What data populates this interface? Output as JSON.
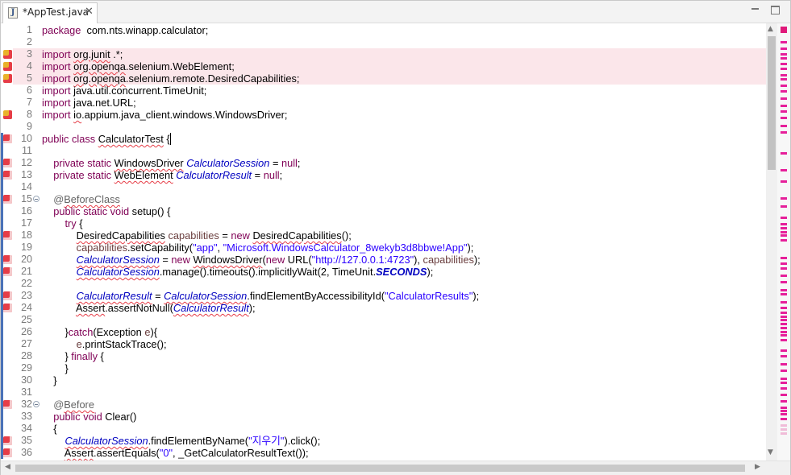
{
  "tab": {
    "icon": "java-file-icon",
    "title": "*AppTest.java",
    "close_glyph": "☒"
  },
  "window_buttons": {
    "minimize": "minimize-icon",
    "maximize": "maximize-icon"
  },
  "colors": {
    "keyword": "#7f0055",
    "string": "#2a00ff",
    "field": "#0000c0",
    "error": "#e63d47",
    "ruler_mark": "#e61f9a",
    "change_bar": "#4a72b8"
  },
  "editor": {
    "lines": [
      {
        "n": "1",
        "tokens": [
          [
            "kw",
            "package"
          ],
          [
            "",
            "  com.nts.winapp.calculator;"
          ]
        ]
      },
      {
        "n": "2",
        "tokens": []
      },
      {
        "n": "3",
        "tokens": [
          [
            "kw",
            "import"
          ],
          [
            "",
            " "
          ],
          [
            "sq",
            "org.junit"
          ],
          [
            "",
            " .*;"
          ]
        ]
      },
      {
        "n": "4",
        "tokens": [
          [
            "kw",
            "import"
          ],
          [
            "",
            " "
          ],
          [
            "sq",
            "org.openqa"
          ],
          [
            "",
            ".selenium.WebElement;"
          ]
        ]
      },
      {
        "n": "5",
        "tokens": [
          [
            "kw",
            "import"
          ],
          [
            "",
            " "
          ],
          [
            "sq",
            "org.openqa"
          ],
          [
            "",
            ".selenium.remote.DesiredCapabilities;"
          ]
        ]
      },
      {
        "n": "6",
        "tokens": [
          [
            "kw",
            "import"
          ],
          [
            "",
            " java.util.concurrent.TimeUnit;"
          ]
        ]
      },
      {
        "n": "7",
        "tokens": [
          [
            "kw",
            "import"
          ],
          [
            "",
            " java.net.URL;"
          ]
        ]
      },
      {
        "n": "8",
        "tokens": [
          [
            "kw",
            "import"
          ],
          [
            "",
            " "
          ],
          [
            "sq",
            "io"
          ],
          [
            "",
            ".appium.java_client.windows.WindowsDriver;"
          ]
        ]
      },
      {
        "n": "9",
        "tokens": []
      },
      {
        "n": "10",
        "tokens": [
          [
            "kw",
            "public class"
          ],
          [
            "",
            " "
          ],
          [
            "sq",
            "CalculatorTest"
          ],
          [
            "",
            " "
          ],
          [
            "caret",
            "{"
          ]
        ]
      },
      {
        "n": "11",
        "tokens": []
      },
      {
        "n": "12",
        "tokens": [
          [
            "",
            "    "
          ],
          [
            "kw",
            "private static"
          ],
          [
            "",
            " "
          ],
          [
            "sq",
            "WindowsDriver"
          ],
          [
            "",
            " "
          ],
          [
            "it",
            "CalculatorSession"
          ],
          [
            "",
            " = "
          ],
          [
            "kw",
            "null"
          ],
          [
            "",
            ";"
          ]
        ]
      },
      {
        "n": "13",
        "tokens": [
          [
            "",
            "    "
          ],
          [
            "kw",
            "private static"
          ],
          [
            "",
            " "
          ],
          [
            "sq",
            "WebElement"
          ],
          [
            "",
            " "
          ],
          [
            "it",
            "CalculatorResult"
          ],
          [
            "",
            " = "
          ],
          [
            "kw",
            "null"
          ],
          [
            "",
            ";"
          ]
        ]
      },
      {
        "n": "14",
        "tokens": []
      },
      {
        "n": "15",
        "tokens": [
          [
            "",
            "    "
          ],
          [
            "an",
            "@"
          ],
          [
            "ansq",
            "BeforeClass"
          ]
        ]
      },
      {
        "n": "16",
        "tokens": [
          [
            "",
            "    "
          ],
          [
            "kw",
            "public static void"
          ],
          [
            "",
            " setup() {"
          ]
        ]
      },
      {
        "n": "17",
        "tokens": [
          [
            "",
            "        "
          ],
          [
            "kw",
            "try"
          ],
          [
            "",
            " {"
          ]
        ]
      },
      {
        "n": "18",
        "tokens": [
          [
            "",
            "            "
          ],
          [
            "sq",
            "DesiredCapabilities"
          ],
          [
            "",
            " "
          ],
          [
            "var",
            "capabilities"
          ],
          [
            "",
            " = "
          ],
          [
            "kw",
            "new"
          ],
          [
            "",
            " "
          ],
          [
            "sq",
            "DesiredCapabilities"
          ],
          [
            "",
            "();"
          ]
        ]
      },
      {
        "n": "19",
        "tokens": [
          [
            "",
            "            "
          ],
          [
            "var",
            "capabilities"
          ],
          [
            "",
            ".setCapability("
          ],
          [
            "str",
            "\"app\""
          ],
          [
            "",
            ", "
          ],
          [
            "str",
            "\"Microsoft.WindowsCalculator_8wekyb3d8bbwe!App\""
          ],
          [
            "",
            ");"
          ]
        ]
      },
      {
        "n": "20",
        "tokens": [
          [
            "",
            "            "
          ],
          [
            "itsq",
            "CalculatorSession"
          ],
          [
            "",
            " = "
          ],
          [
            "kw",
            "new"
          ],
          [
            "",
            " "
          ],
          [
            "sq",
            "WindowsDriver"
          ],
          [
            "",
            "("
          ],
          [
            "kw",
            "new"
          ],
          [
            "",
            " URL("
          ],
          [
            "str",
            "\"http://127.0.0.1:4723\""
          ],
          [
            "",
            "), "
          ],
          [
            "var",
            "capabilities"
          ],
          [
            "",
            ");"
          ]
        ]
      },
      {
        "n": "21",
        "tokens": [
          [
            "",
            "            "
          ],
          [
            "itsq",
            "CalculatorSession"
          ],
          [
            "",
            ".manage().timeouts().implicitlyWait(2, TimeUnit."
          ],
          [
            "itb",
            "SECONDS"
          ],
          [
            "",
            ");"
          ]
        ]
      },
      {
        "n": "22",
        "tokens": []
      },
      {
        "n": "23",
        "tokens": [
          [
            "",
            "            "
          ],
          [
            "itsq",
            "CalculatorResult"
          ],
          [
            "",
            " = "
          ],
          [
            "itsq",
            "CalculatorSession"
          ],
          [
            "",
            ".findElementByAccessibilityId("
          ],
          [
            "str",
            "\"CalculatorResults\""
          ],
          [
            "",
            ");"
          ]
        ]
      },
      {
        "n": "24",
        "tokens": [
          [
            "",
            "            "
          ],
          [
            "sq",
            "Assert"
          ],
          [
            "",
            ".assertNotNull("
          ],
          [
            "itsq",
            "CalculatorResult"
          ],
          [
            "",
            ");"
          ]
        ]
      },
      {
        "n": "25",
        "tokens": []
      },
      {
        "n": "26",
        "tokens": [
          [
            "",
            "        }"
          ],
          [
            "kw",
            "catch"
          ],
          [
            "",
            "(Exception "
          ],
          [
            "var",
            "e"
          ],
          [
            "",
            "){"
          ]
        ]
      },
      {
        "n": "27",
        "tokens": [
          [
            "",
            "            "
          ],
          [
            "var",
            "e"
          ],
          [
            "",
            ".printStackTrace();"
          ]
        ]
      },
      {
        "n": "28",
        "tokens": [
          [
            "",
            "        } "
          ],
          [
            "kw",
            "finally"
          ],
          [
            "",
            " {"
          ]
        ]
      },
      {
        "n": "29",
        "tokens": [
          [
            "",
            "        }"
          ]
        ]
      },
      {
        "n": "30",
        "tokens": [
          [
            "",
            "    }"
          ]
        ]
      },
      {
        "n": "31",
        "tokens": []
      },
      {
        "n": "32",
        "tokens": [
          [
            "",
            "    "
          ],
          [
            "an",
            "@"
          ],
          [
            "ansq",
            "Before"
          ]
        ]
      },
      {
        "n": "33",
        "tokens": [
          [
            "",
            "    "
          ],
          [
            "kw",
            "public void"
          ],
          [
            "",
            " Clear()"
          ]
        ]
      },
      {
        "n": "34",
        "tokens": [
          [
            "",
            "    {"
          ]
        ]
      },
      {
        "n": "35",
        "tokens": [
          [
            "",
            "        "
          ],
          [
            "itsq",
            "CalculatorSession"
          ],
          [
            "",
            ".findElementByName("
          ],
          [
            "str",
            "\"지우기\""
          ],
          [
            "",
            ").click();"
          ]
        ]
      },
      {
        "n": "36",
        "tokens": [
          [
            "",
            "        "
          ],
          [
            "sq",
            "Assert"
          ],
          [
            "",
            ".assertEquals("
          ],
          [
            "str",
            "\"0\""
          ],
          [
            "",
            ", _GetCalculatorResultText());"
          ]
        ]
      }
    ]
  }
}
